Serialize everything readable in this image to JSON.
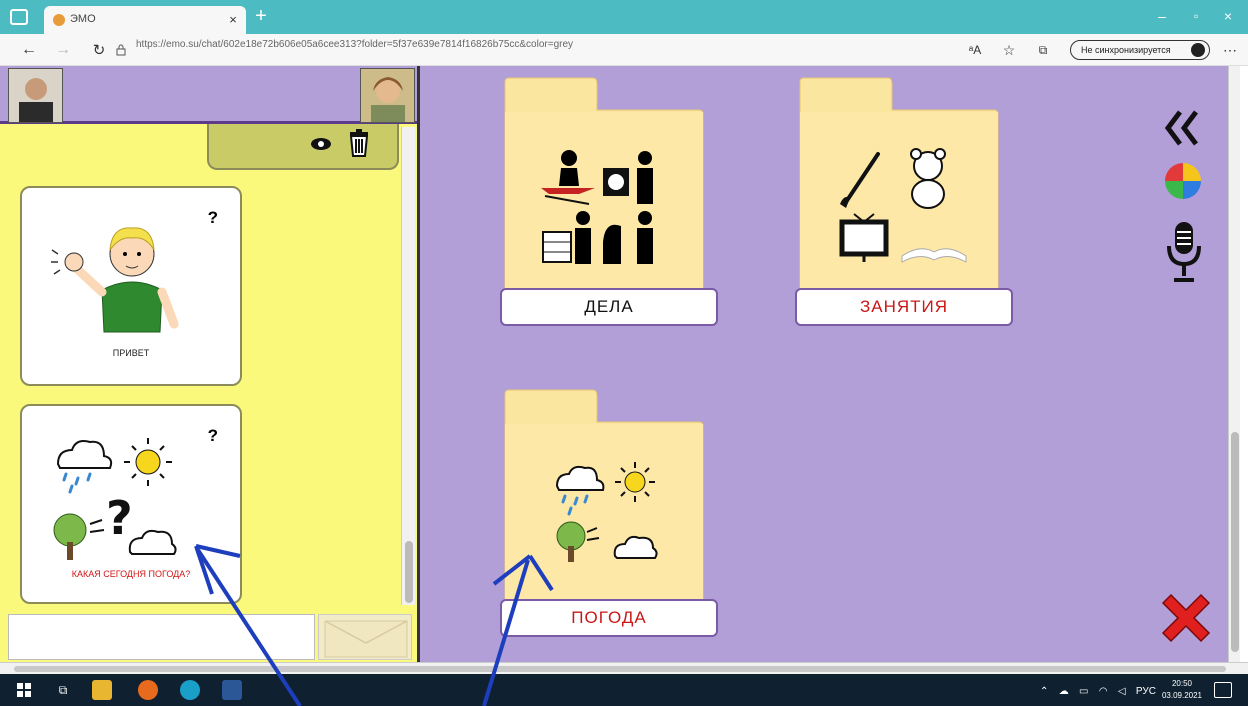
{
  "browser": {
    "tab_title": "ЭМО",
    "url": "https://emo.su/chat/602e18e72b606e05a6cee313?folder=5f37e639e7814f16826b75cc&color=grey",
    "sync_label": "Не синхронизируется"
  },
  "left": {
    "cards": [
      {
        "label": "ПРИВЕТ",
        "question": "?"
      },
      {
        "label": "КАКАЯ СЕГОДНЯ ПОГОДА?",
        "question": "?"
      }
    ]
  },
  "folders": [
    {
      "label": "ДЕЛА"
    },
    {
      "label": "ЗАНЯТИЯ"
    },
    {
      "label": "ПОГОДА"
    }
  ],
  "taskbar": {
    "time": "20:50",
    "date": "03.09.2021",
    "lang": "РУС"
  }
}
